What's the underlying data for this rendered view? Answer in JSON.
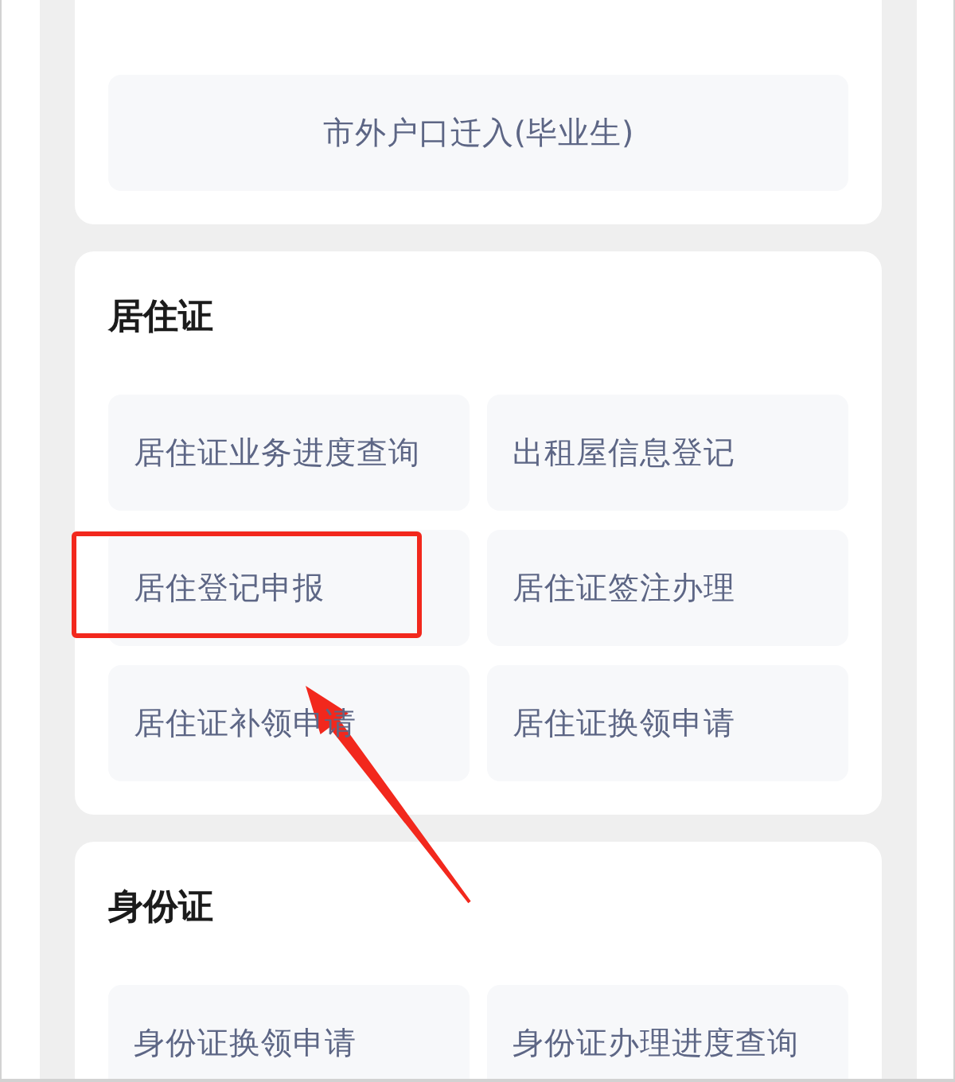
{
  "sections": [
    {
      "kind": "single",
      "items": [
        {
          "label": "市外户口迁入(毕业生)",
          "highlighted": false
        }
      ]
    },
    {
      "title": "居住证",
      "kind": "grid",
      "items": [
        {
          "label": "居住证业务进度查询",
          "highlighted": false
        },
        {
          "label": "出租屋信息登记",
          "highlighted": false
        },
        {
          "label": "居住登记申报",
          "highlighted": true
        },
        {
          "label": "居住证签注办理",
          "highlighted": false
        },
        {
          "label": "居住证补领申请",
          "highlighted": false
        },
        {
          "label": "居住证换领申请",
          "highlighted": false
        }
      ]
    },
    {
      "title": "身份证",
      "kind": "grid",
      "items": [
        {
          "label": "身份证换领申请",
          "highlighted": false
        },
        {
          "label": "身份证办理进度查询",
          "highlighted": false
        }
      ]
    }
  ]
}
